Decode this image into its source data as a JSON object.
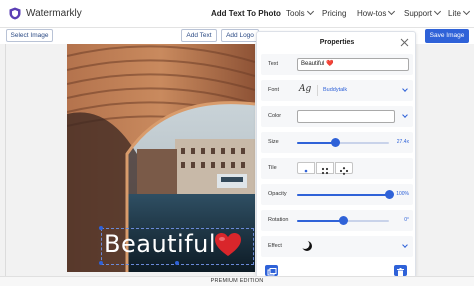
{
  "nav": {
    "brand": "Watermarkly",
    "links": [
      {
        "label": "Add Text To Photo"
      },
      {
        "label": "Tools"
      },
      {
        "label": "Pricing"
      },
      {
        "label": "How-tos"
      },
      {
        "label": "Support"
      },
      {
        "label": "Lite"
      }
    ]
  },
  "toolbar": {
    "select_image": "Select Image",
    "add_text": "Add Text",
    "add_logo": "Add Logo",
    "save_image": "Save Image"
  },
  "canvas": {
    "text_content": "Beautiful"
  },
  "properties": {
    "title": "Properties",
    "text_label": "Text",
    "text_value": "Beautiful ❤️",
    "font_label": "Font",
    "font_sample": "Ag",
    "font_name": "Buddytalk",
    "color_label": "Color",
    "size_label": "Size",
    "size_value": "27.4x",
    "size_level": 0.42,
    "tile_label": "Tile",
    "opacity_label": "Opacity",
    "opacity_value": "100%",
    "opacity_level": 1.0,
    "rotation_label": "Rotation",
    "rotation_value": "0°",
    "rotation_level": 0.5,
    "effect_label": "Effect"
  },
  "footer": {
    "edition": "PREMIUM EDITION"
  },
  "colors": {
    "accent": "#2f62d8",
    "brand_logo": "#5b3fb5"
  },
  "icons": [
    "shield-logo-icon",
    "close-icon",
    "font-icon",
    "chevron-down-icon",
    "tile-single-icon",
    "tile-grid-icon",
    "tile-diamond-icon",
    "moon-effect-icon",
    "duplicate-icon",
    "trash-icon",
    "heart-icon"
  ]
}
